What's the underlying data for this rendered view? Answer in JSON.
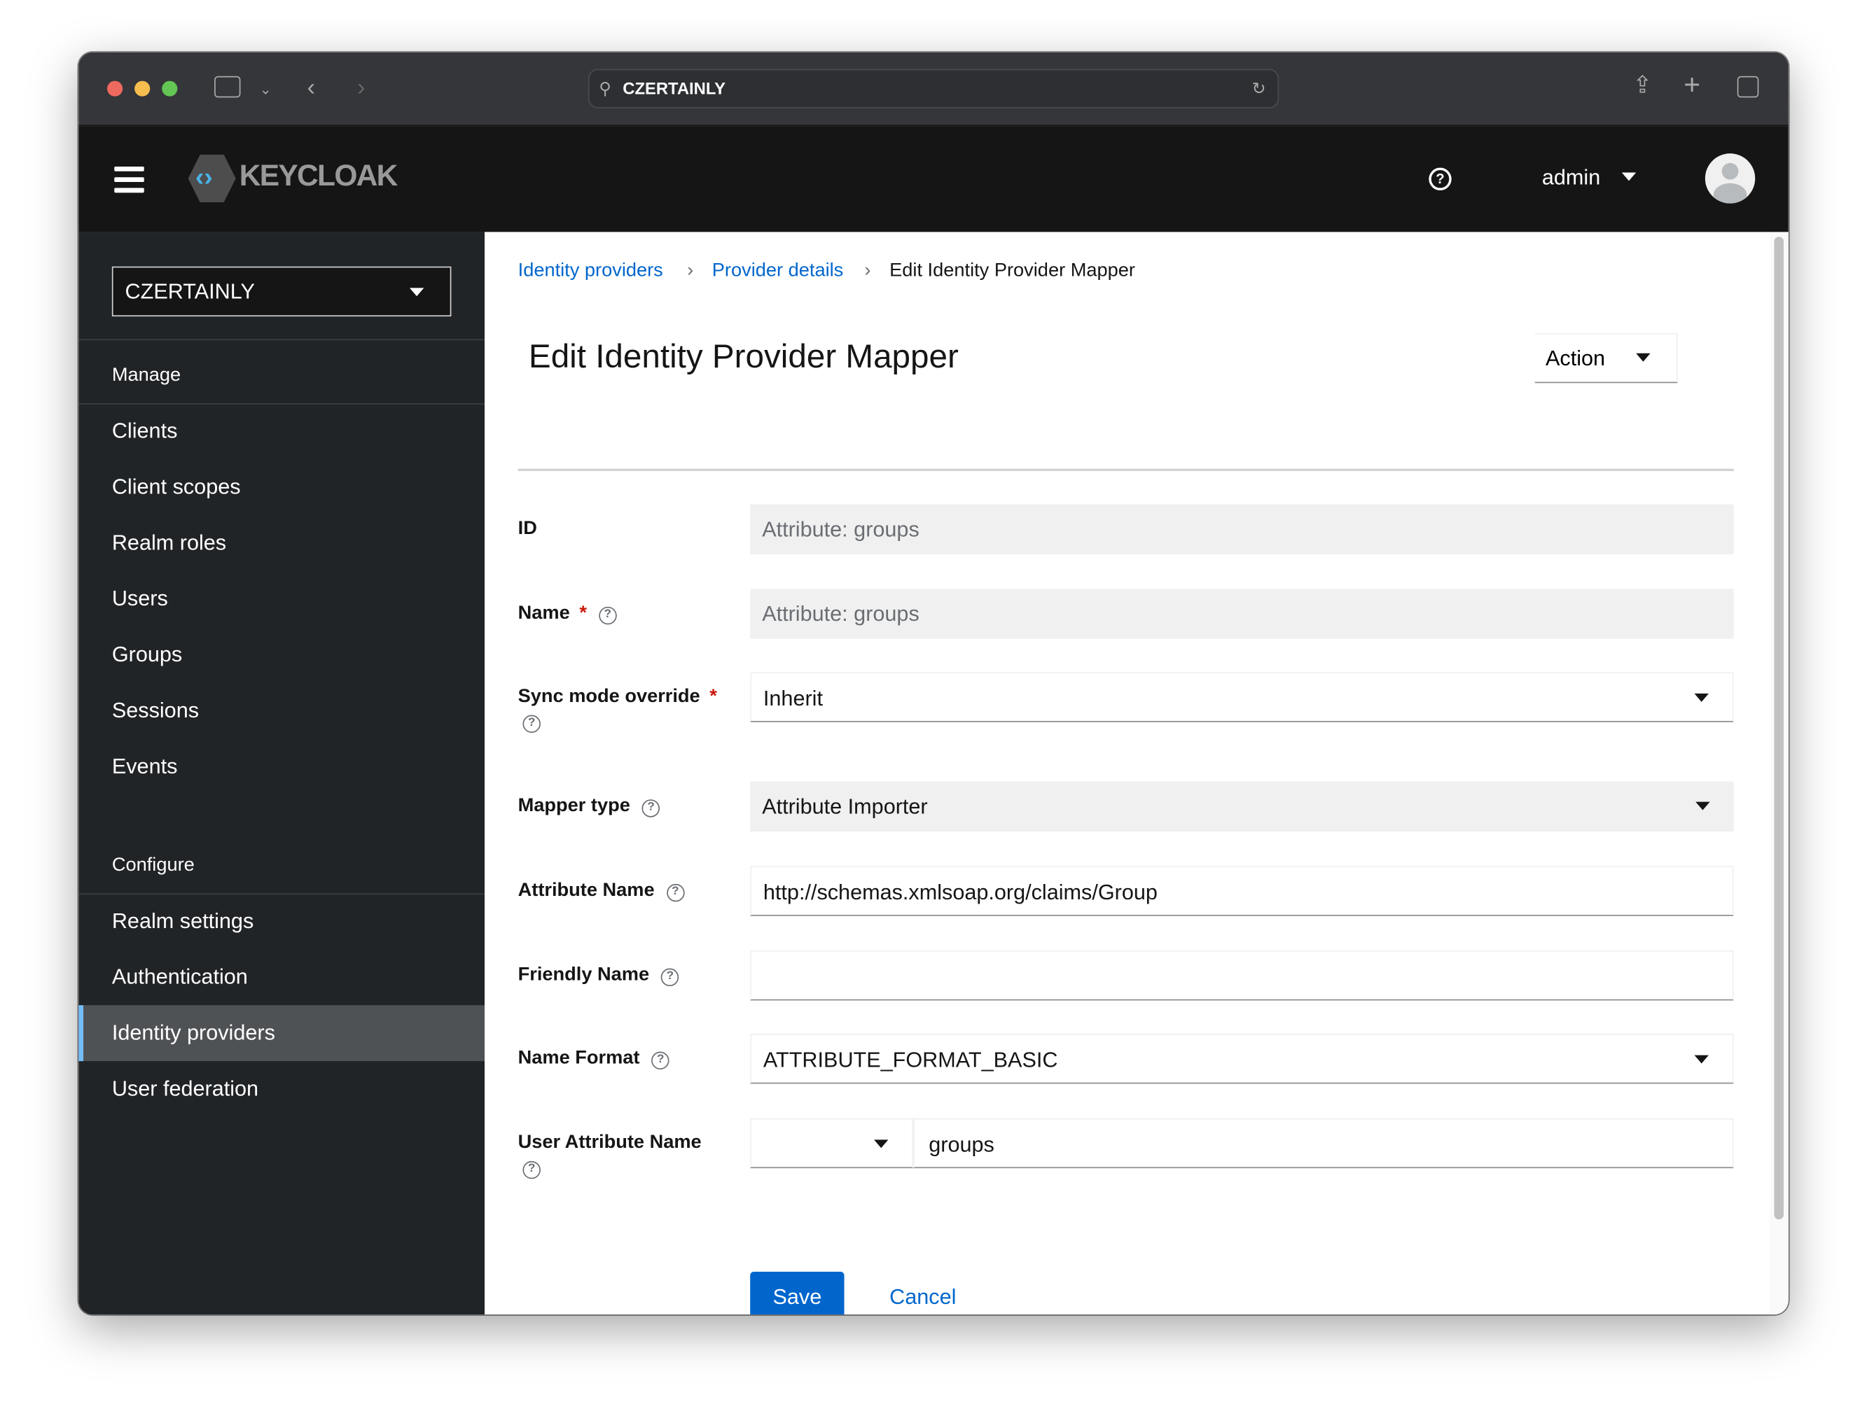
{
  "browser": {
    "url": "CZERTAINLY",
    "traffic_colors": [
      "#ee6a5f",
      "#f5be4f",
      "#62c554"
    ]
  },
  "header": {
    "logo": "KEYCLOAK",
    "user": "admin"
  },
  "sidebar": {
    "realm": "CZERTAINLY",
    "manage_label": "Manage",
    "manage_items": [
      "Clients",
      "Client scopes",
      "Realm roles",
      "Users",
      "Groups",
      "Sessions",
      "Events"
    ],
    "configure_label": "Configure",
    "configure_items": [
      "Realm settings",
      "Authentication",
      "Identity providers",
      "User federation"
    ],
    "active": "Identity providers"
  },
  "breadcrumb": [
    "Identity providers",
    "Provider details",
    "Edit Identity Provider Mapper"
  ],
  "page": {
    "title": "Edit Identity Provider Mapper",
    "action": "Action"
  },
  "form": {
    "id": {
      "label": "ID",
      "value": "Attribute: groups"
    },
    "name": {
      "label": "Name",
      "value": "Attribute: groups"
    },
    "sync": {
      "label": "Sync mode override",
      "value": "Inherit"
    },
    "mapper_type": {
      "label": "Mapper type",
      "value": "Attribute Importer"
    },
    "attribute_name": {
      "label": "Attribute Name",
      "value": "http://schemas.xmlsoap.org/claims/Group"
    },
    "friendly_name": {
      "label": "Friendly Name",
      "value": ""
    },
    "name_format": {
      "label": "Name Format",
      "value": "ATTRIBUTE_FORMAT_BASIC"
    },
    "user_attribute": {
      "label": "User Attribute Name",
      "select": "",
      "value": "groups"
    },
    "save": "Save",
    "cancel": "Cancel"
  },
  "colors": {
    "link": "#0066cc",
    "primary": "#0066cc",
    "active_border": "#73bcf7"
  }
}
